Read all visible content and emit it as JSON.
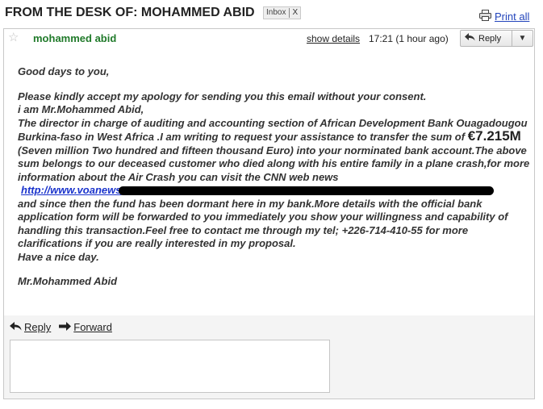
{
  "subject": "FROM THE DESK OF: MOHAMMED ABID",
  "label": {
    "name": "Inbox",
    "remove": "X"
  },
  "toolbar": {
    "print_all": "Print all"
  },
  "message": {
    "sender": "mohammed abid",
    "show_details": "show details",
    "time": "17:21 (1 hour ago)",
    "reply_button": "Reply",
    "body": {
      "greeting": "Good days to you,",
      "line1": "Please kindly accept my apology for sending you this email without your consent.",
      "line2": "i am Mr.Mohammed Abid,",
      "line3": "The director in charge of auditing and accounting section of  African Development Bank Ouagadougou Burkina-faso in West Africa .I am writing to request your assistance to transfer the sum of ",
      "amount": "€7.215M",
      "line3b": " (Seven million Two hundred and fifteen thousand Euro) into your norminated bank account.The above sum belongs to our deceased customer who died along with his entire family in a plane crash,for  more information about  the Air Crash you can visit the CNN web news",
      "link": "http://www.voanews",
      "line4": " and since then the fund has been dormant here in my bank.More details  with the official bank application form will be forwarded to you immediately you show your willingness and capability of handling this transaction.Feel free to contact me through my tel; +226-714-410-55 for more clarifications if you are really interested in my proposal.",
      "line5": "Have a nice day.",
      "signature": "Mr.Mohammed Abid"
    }
  },
  "footer": {
    "reply": "Reply",
    "forward": "Forward"
  },
  "colors": {
    "sender": "#207a2a",
    "link": "#1a33cc",
    "print_link": "#2244bb"
  },
  "icons": [
    "printer-icon",
    "star-icon",
    "reply-arrow-icon",
    "chevron-down-icon",
    "forward-arrow-icon"
  ]
}
